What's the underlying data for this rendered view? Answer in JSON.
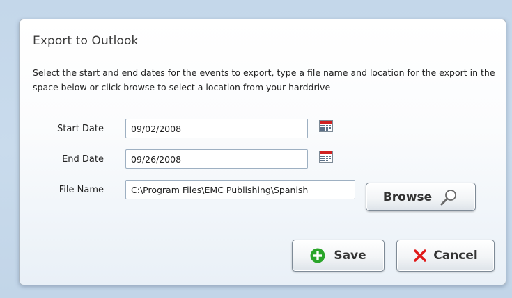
{
  "dialog": {
    "title": "Export to Outlook",
    "description": "Select the start and end dates for the events to export, type a file name and location for the export in the space below or click browse to select a location from your harddrive"
  },
  "form": {
    "start_date": {
      "label": "Start Date",
      "value": "09/02/2008"
    },
    "end_date": {
      "label": "End Date",
      "value": "09/26/2008"
    },
    "file_name": {
      "label": "File Name",
      "value": "C:\\Program Files\\EMC Publishing\\Spanish"
    }
  },
  "buttons": {
    "browse": {
      "label": "Browse",
      "icon": "magnifier-icon"
    },
    "save": {
      "label": "Save",
      "icon": "plus-circle-icon",
      "color": "#2aa52a"
    },
    "cancel": {
      "label": "Cancel",
      "icon": "x-icon",
      "color": "#e01818"
    }
  },
  "colors": {
    "background": "#c4d7ea",
    "calendar_header": "#d02020"
  }
}
